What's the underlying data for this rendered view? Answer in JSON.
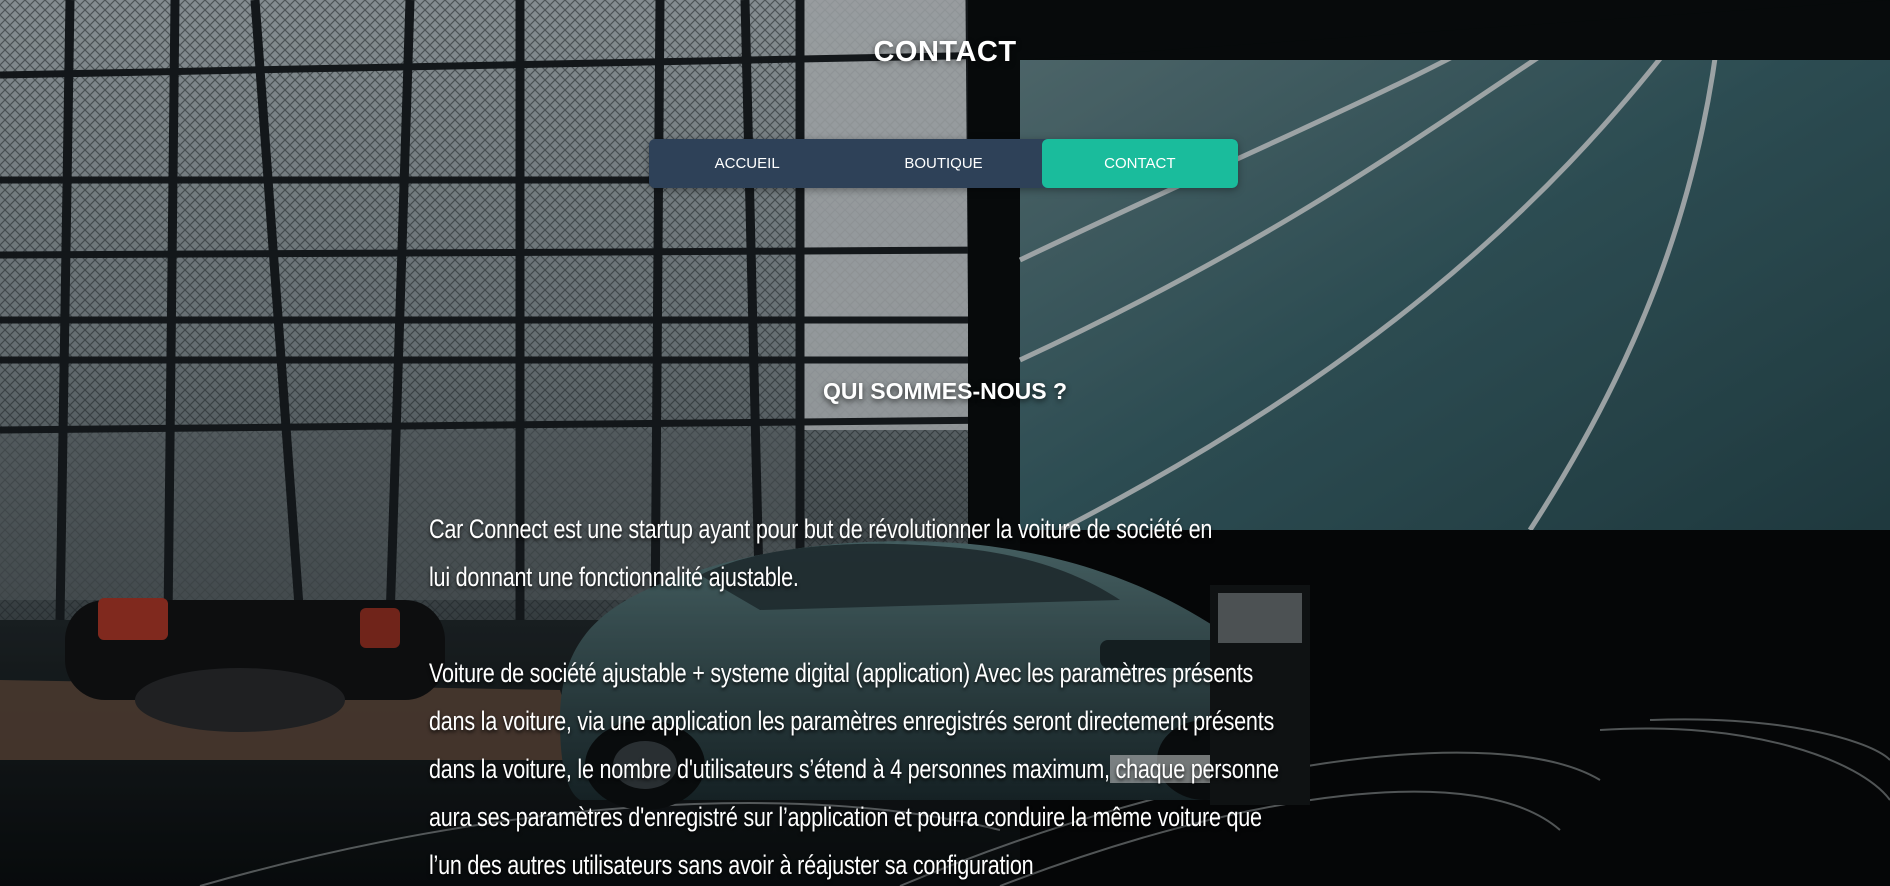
{
  "page": {
    "title": "CONTACT"
  },
  "nav": {
    "items": [
      {
        "label": "ACCUEIL",
        "active": false
      },
      {
        "label": "BOUTIQUE",
        "active": false
      },
      {
        "label": "CONTACT",
        "active": true
      }
    ],
    "colors": {
      "bar": "#2e4158",
      "active": "#1abc9c"
    }
  },
  "about": {
    "heading": "QUI SOMMES-NOUS ?",
    "paragraph_1": "Car Connect est une startup ayant pour but de révolutionner la voiture de société en lui donnant une fonctionnalité ajustable.",
    "paragraph_2": "Voiture de société ajustable + systeme digital (application) Avec les paramètres présents dans la voiture, via une application les paramètres enregistrés seront directement présents dans la voiture, le nombre d'utilisateurs s’étend à 4 personnes maximum, chaque personne aura ses paramètres d'enregistré sur l’application et pourra conduire la même voiture que l’un des autres utilisateurs sans avoir à réajuster sa configuration"
  },
  "background": {
    "image": "car-showroom-photo"
  }
}
